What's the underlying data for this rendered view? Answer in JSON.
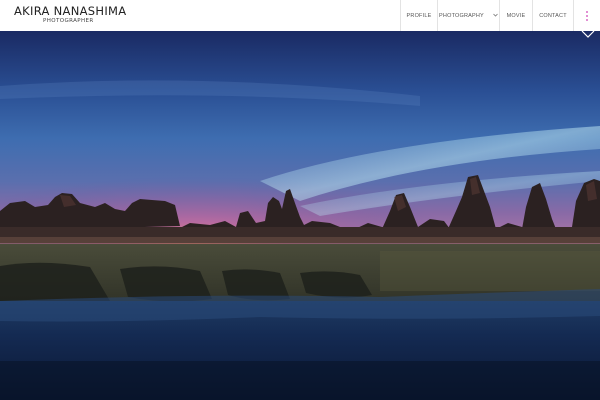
{
  "header": {
    "brand_name": "AKIRA NANASHIMA",
    "brand_subtitle": "PHOTOGRAPHER"
  },
  "nav": {
    "items": [
      {
        "label": "PROFILE"
      },
      {
        "label": "PHOTOGRAPHY",
        "has_dropdown": true
      },
      {
        "label": "MOVIE"
      },
      {
        "label": "CONTACT"
      }
    ],
    "extra_icon": "menu-dots-icon",
    "dropdown_icon": "chevron-down-icon"
  },
  "hero": {
    "content": "night landscape photo of rock pillars along a shoreline under a blue sky with pink glow at the horizon"
  },
  "colors": {
    "sky_top": "#1a2c66",
    "sky_mid": "#3f6fb5",
    "horizon_glow": "#d07fa8",
    "water": "#0f1e3c",
    "accent": "#d96cc7"
  }
}
